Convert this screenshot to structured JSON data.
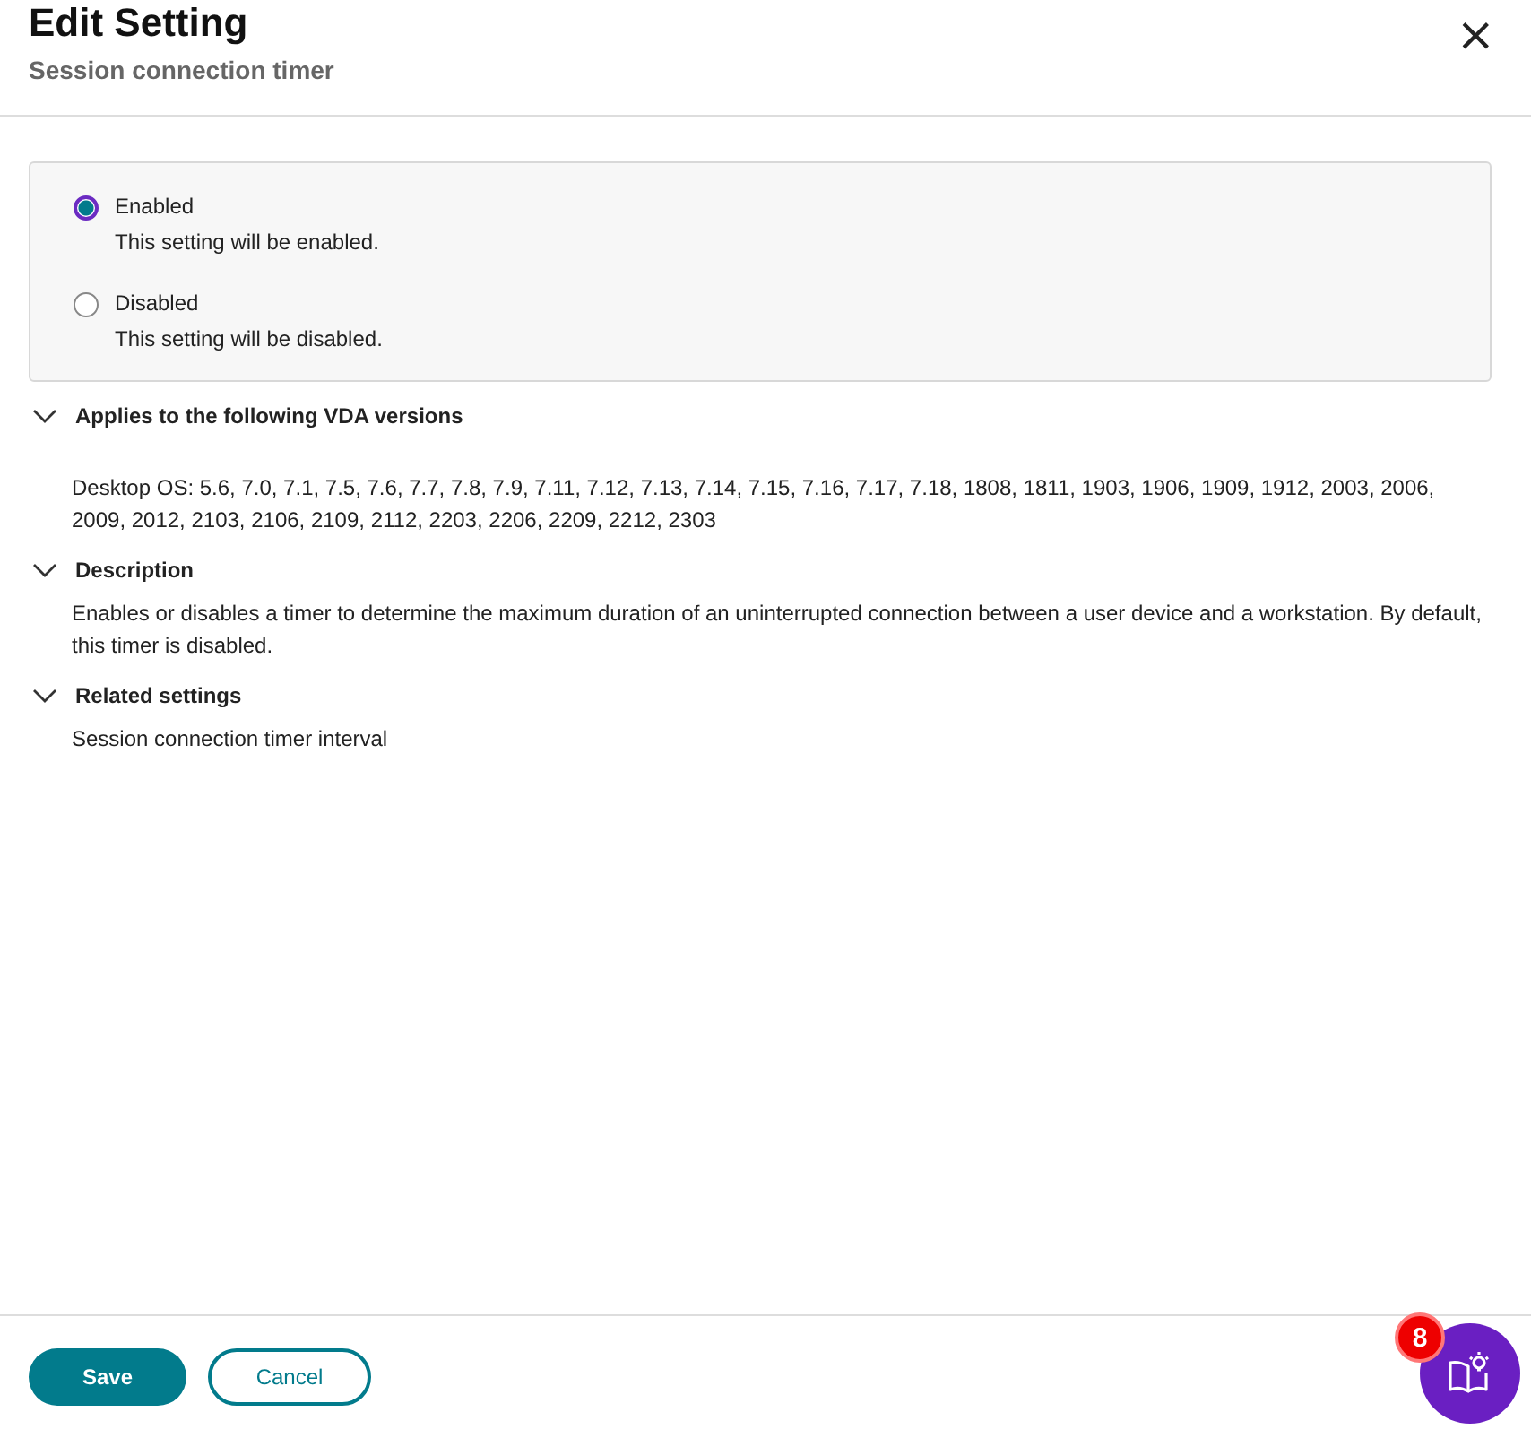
{
  "header": {
    "title": "Edit Setting",
    "subtitle": "Session connection timer",
    "close": "×"
  },
  "options": [
    {
      "label": "Enabled",
      "hint": "This setting will be enabled.",
      "selected": true
    },
    {
      "label": "Disabled",
      "hint": "This setting will be disabled.",
      "selected": false
    }
  ],
  "sections": [
    {
      "title": "Applies to the following VDA versions",
      "expanded": true,
      "kind": "versions",
      "text": "Desktop OS: 5.6, 7.0, 7.1, 7.5, 7.6, 7.7, 7.8, 7.9, 7.11, 7.12, 7.13, 7.14, 7.15, 7.16, 7.17, 7.18, 1808, 1811, 1903, 1906, 1909, 1912, 2003, 2006, 2009, 2012, 2103, 2106, 2109, 2112, 2203, 2206, 2209, 2212, 2303"
    },
    {
      "title": "Description",
      "expanded": true,
      "kind": "text",
      "text": "Enables or disables a timer to determine the maximum duration of an uninterrupted connection between a user device and a workstation. By default, this timer is disabled."
    },
    {
      "title": "Related settings",
      "expanded": true,
      "kind": "text",
      "text": "Session connection timer interval"
    }
  ],
  "buttons": [
    {
      "label": "Save",
      "kind": "primary"
    },
    {
      "label": "Cancel",
      "kind": "secondary"
    }
  ],
  "help_badge": "8"
}
